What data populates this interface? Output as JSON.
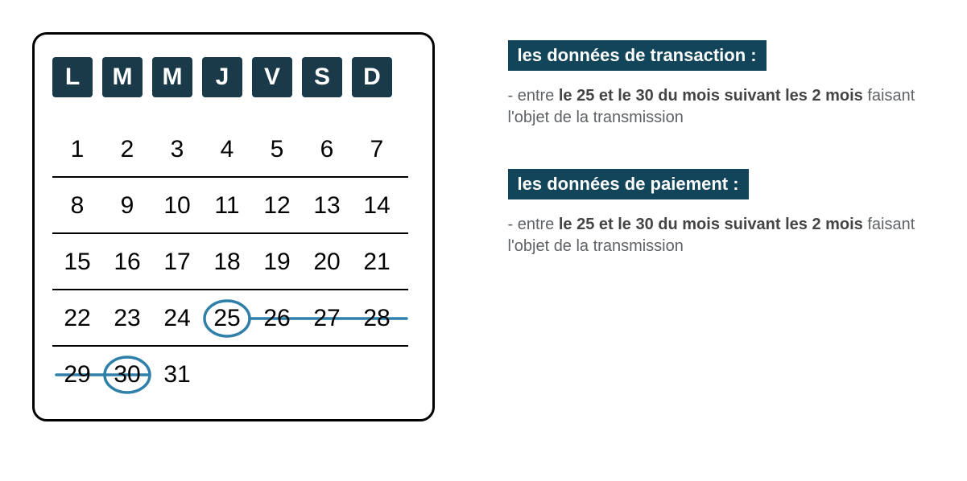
{
  "calendar": {
    "headers": [
      "L",
      "M",
      "M",
      "J",
      "V",
      "S",
      "D"
    ],
    "rows": [
      [
        "1",
        "2",
        "3",
        "4",
        "5",
        "6",
        "7"
      ],
      [
        "8",
        "9",
        "10",
        "11",
        "12",
        "13",
        "14"
      ],
      [
        "15",
        "16",
        "17",
        "18",
        "19",
        "20",
        "21"
      ],
      [
        "22",
        "23",
        "24",
        "25",
        "26",
        "27",
        "28"
      ],
      [
        "29",
        "30",
        "31",
        "",
        "",
        "",
        ""
      ]
    ],
    "highlight": {
      "circled": [
        25,
        30
      ],
      "strike_range": [
        25,
        30
      ]
    }
  },
  "info": {
    "block1": {
      "title": "les données de transaction :",
      "prefix": "- entre ",
      "bold": "le 25 et le 30 du mois suivant les 2 mois",
      "suffix": " faisant l'objet de la transmission"
    },
    "block2": {
      "title": "les données de paiement :",
      "prefix": "- entre ",
      "bold": "le 25 et le 30 du mois suivant les 2 mois",
      "suffix": " faisant l'objet de la transmission"
    }
  }
}
